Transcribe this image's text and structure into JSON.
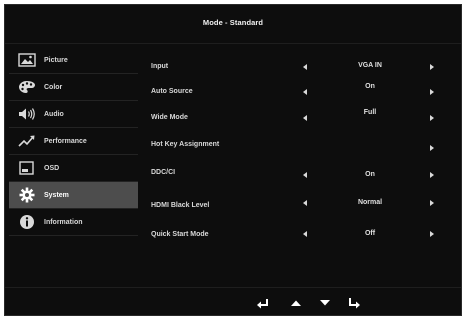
{
  "title": "Mode - Standard",
  "sidebar": {
    "active_index": 5,
    "items": [
      {
        "label": "Picture",
        "icon": "picture-icon"
      },
      {
        "label": "Color",
        "icon": "palette-icon"
      },
      {
        "label": "Audio",
        "icon": "speaker-icon"
      },
      {
        "label": "Performance",
        "icon": "performance-icon"
      },
      {
        "label": "OSD",
        "icon": "osd-icon"
      },
      {
        "label": "System",
        "icon": "gear-icon"
      },
      {
        "label": "Information",
        "icon": "info-icon"
      }
    ]
  },
  "settings": [
    {
      "name": "Input",
      "value": "VGA IN"
    },
    {
      "name": "Auto Source",
      "value": "On"
    },
    {
      "name": "Wide Mode",
      "value": "Full"
    },
    {
      "name": "Hot Key Assignment",
      "value": ""
    },
    {
      "name": "DDC/CI",
      "value": "On"
    },
    {
      "name": "HDMI Black Level",
      "value": "Normal"
    },
    {
      "name": "Quick Start Mode",
      "value": "Off"
    }
  ],
  "nav_icons": [
    "back-icon",
    "up-icon",
    "down-icon",
    "enter-icon"
  ]
}
